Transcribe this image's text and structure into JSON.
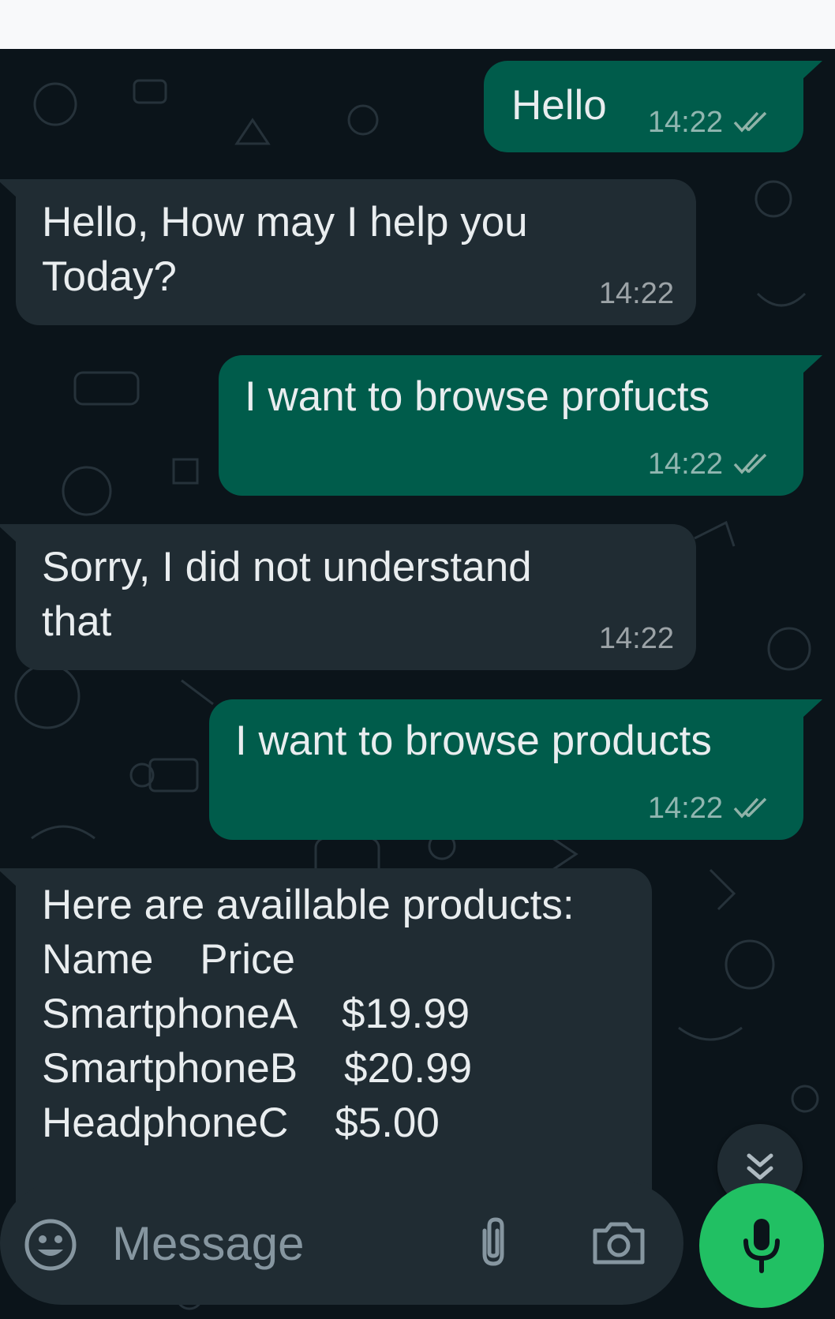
{
  "colors": {
    "chat_bg": "#0b141a",
    "outgoing_bubble": "#005c4b",
    "incoming_bubble": "#202c33",
    "text": "#e9edef",
    "meta_text": "#8696a0",
    "accent_green": "#21c063"
  },
  "messages": [
    {
      "direction": "outgoing",
      "text": "Hello",
      "time": "14:22",
      "status_icon": "double-check-icon"
    },
    {
      "direction": "incoming",
      "text": "Hello, How may I help you\nToday?",
      "time": "14:22"
    },
    {
      "direction": "outgoing",
      "text": "I want to browse profucts",
      "time": "14:22",
      "status_icon": "double-check-icon"
    },
    {
      "direction": "incoming",
      "text": "Sorry, I did not understand\nthat",
      "time": "14:22"
    },
    {
      "direction": "outgoing",
      "text": "I want to browse products",
      "time": "14:22",
      "status_icon": "double-check-icon"
    },
    {
      "direction": "incoming",
      "text": "Here are availlable products:\nName    Price\nSmartphoneA    $19.99\nSmartphoneB    $20.99\nHeadphoneC    $5.00"
    }
  ],
  "composer": {
    "placeholder": "Message",
    "emoji_icon": "emoji-icon",
    "attach_icon": "paperclip-icon",
    "camera_icon": "camera-icon",
    "mic_icon": "mic-icon"
  },
  "scroll_button_icon": "chevron-double-down-icon"
}
